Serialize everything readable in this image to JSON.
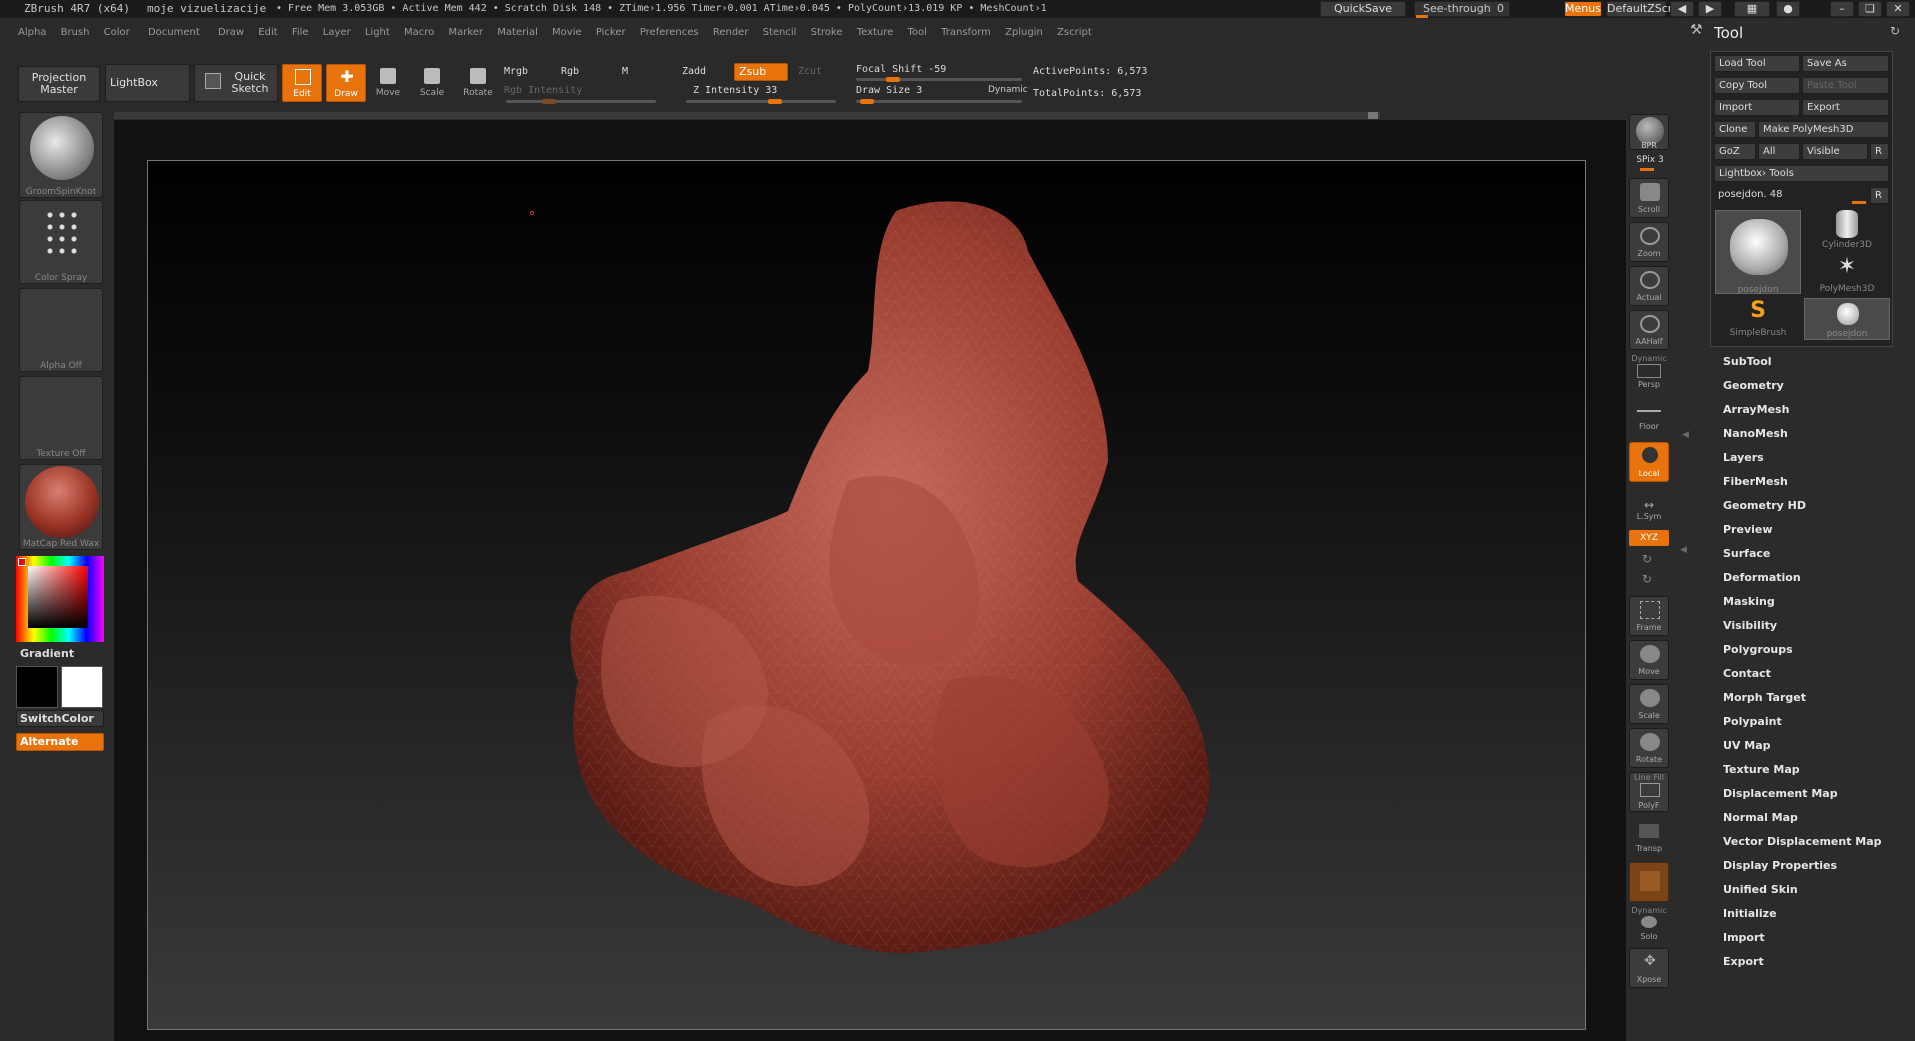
{
  "titlebar": {
    "app_title": "ZBrush 4R7 (x64)",
    "document_name": "moje vizuelizacije",
    "status": "• Free Mem 3.053GB • Active Mem 442 • Scratch Disk 148 •  ZTime›1.956  Timer›0.001  ATime›0.045 • PolyCount›13.019 KP • MeshCount›1",
    "quicksave": "QuickSave",
    "see_through": "See-through",
    "see_through_value": "0",
    "menus": "Menus",
    "script": "DefaultZScript"
  },
  "menubar": {
    "items": [
      "Alpha",
      "Brush",
      "Color",
      "Document",
      "Draw",
      "Edit",
      "File",
      "Layer",
      "Light",
      "Macro",
      "Marker",
      "Material",
      "Movie",
      "Picker",
      "Preferences",
      "Render",
      "Stencil",
      "Stroke",
      "Texture",
      "Tool",
      "Transform",
      "Zplugin",
      "Zscript"
    ]
  },
  "toolbar": {
    "projection_master": "Projection Master",
    "lightbox": "LightBox",
    "quick_sketch": "Quick Sketch",
    "edit": "Edit",
    "draw": "Draw",
    "move": "Move",
    "scale": "Scale",
    "rotate": "Rotate",
    "mrgb": "Mrgb",
    "rgb": "Rgb",
    "m": "M",
    "rgb_intensity": "Rgb Intensity",
    "zadd": "Zadd",
    "zsub": "Zsub",
    "zcut": "Zcut",
    "z_intensity": "Z Intensity 33",
    "focal_shift": "Focal Shift -59",
    "draw_size": "Draw Size 3",
    "dynamic": "Dynamic",
    "active_points": "ActivePoints: 6,573",
    "total_points": "TotalPoints: 6,573"
  },
  "leftpanel": {
    "brush": "GroomSpinKnot",
    "stroke": "Color Spray",
    "alpha": "Alpha Off",
    "texture": "Texture Off",
    "material": "MatCap Red Wax",
    "gradient": "Gradient",
    "switch_color": "SwitchColor",
    "alternate": "Alternate"
  },
  "rightstrip": {
    "bpr": "BPR",
    "spix": "SPix 3",
    "scroll": "Scroll",
    "zoom": "Zoom",
    "actual": "Actual",
    "aahalf": "AAHalf",
    "dynamic": "Dynamic",
    "persp": "Persp",
    "floor": "Floor",
    "local": "Local",
    "lsym": "L.Sym",
    "xyz": "XYZ",
    "frame": "Frame",
    "move": "Move",
    "scale": "Scale",
    "rotate": "Rotate",
    "line_fill": "Line Fill",
    "polyf": "PolyF",
    "transp": "Transp",
    "dynamic2": "Dynamic",
    "solo": "Solo",
    "xpose": "Xpose"
  },
  "toolpanel": {
    "title": "Tool",
    "load_tool": "Load Tool",
    "save_as": "Save As",
    "copy_tool": "Copy Tool",
    "paste_tool": "Paste Tool",
    "import": "Import",
    "export": "Export",
    "clone": "Clone",
    "make_polymesh": "Make PolyMesh3D",
    "goz": "GoZ",
    "all": "All",
    "visible": "Visible",
    "r": "R",
    "lightbox_tools": "Lightbox› Tools",
    "current_tool": "posejdon. 48",
    "thumbs": [
      "posejdon",
      "Cylinder3D",
      "PolyMesh3D",
      "SimpleBrush",
      "posejdon"
    ],
    "menu": [
      "SubTool",
      "Geometry",
      "ArrayMesh",
      "NanoMesh",
      "Layers",
      "FiberMesh",
      "Geometry HD",
      "Preview",
      "Surface",
      "Deformation",
      "Masking",
      "Visibility",
      "Polygroups",
      "Contact",
      "Morph Target",
      "Polypaint",
      "UV Map",
      "Texture Map",
      "Displacement Map",
      "Normal Map",
      "Vector Displacement Map",
      "Display Properties",
      "Unified Skin",
      "Initialize",
      "Import",
      "Export"
    ]
  }
}
